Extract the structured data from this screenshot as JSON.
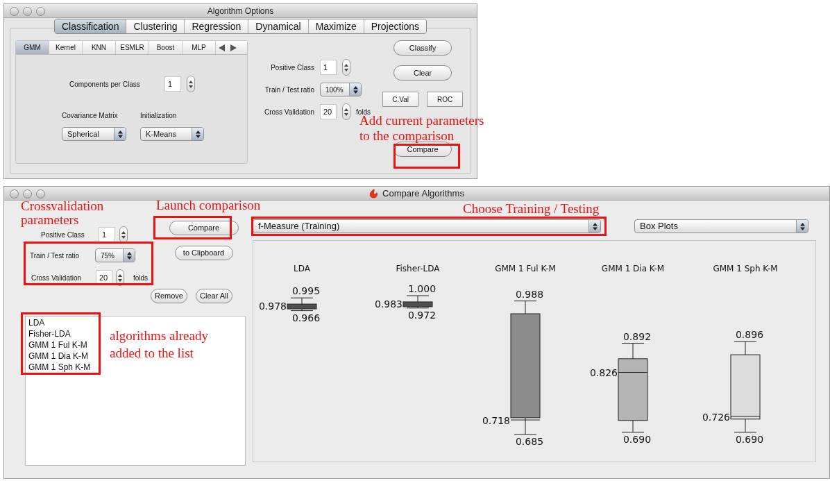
{
  "options_window": {
    "title": "Algorithm Options",
    "tabs": [
      {
        "label": "Classification",
        "selected": true
      },
      {
        "label": "Clustering",
        "selected": false
      },
      {
        "label": "Regression",
        "selected": false
      },
      {
        "label": "Dynamical",
        "selected": false
      },
      {
        "label": "Maximize",
        "selected": false
      },
      {
        "label": "Projections",
        "selected": false
      }
    ],
    "subtabs": [
      {
        "label": "GMM",
        "selected": true
      },
      {
        "label": "Kernel",
        "selected": false
      },
      {
        "label": "KNN",
        "selected": false
      },
      {
        "label": "ESMLR",
        "selected": false
      },
      {
        "label": "Boost",
        "selected": false
      },
      {
        "label": "MLP",
        "selected": false
      }
    ],
    "components_per_class": {
      "label": "Components per Class",
      "value": "1"
    },
    "covariance_matrix": {
      "label": "Covariance Matrix",
      "value": "Spherical"
    },
    "initialization": {
      "label": "Initialization",
      "value": "K-Means"
    },
    "positive_class": {
      "label": "Positive Class",
      "value": "1"
    },
    "train_test_ratio": {
      "label": "Train / Test ratio",
      "value": "100%"
    },
    "cross_validation": {
      "label": "Cross Validation",
      "value": "20",
      "unit": "folds"
    },
    "buttons": [
      "Classify",
      "Clear"
    ],
    "small_buttons": [
      "C.Val",
      "ROC"
    ],
    "compare_button": "Compare"
  },
  "compare_window": {
    "title": "Compare Algorithms",
    "positive_class": {
      "label": "Positive Class",
      "value": "1"
    },
    "train_test_ratio": {
      "label": "Train / Test ratio",
      "value": "75%"
    },
    "cross_validation": {
      "label": "Cross Validation",
      "value": "20",
      "unit": "folds"
    },
    "compare_button": "Compare",
    "clipboard_button": "to Clipboard",
    "remove_button": "Remove",
    "clear_all_button": "Clear All",
    "algorithms": [
      "LDA",
      "Fisher-LDA",
      "GMM 1 Ful K-M",
      "GMM 1 Dia K-M",
      "GMM 1 Sph K-M"
    ],
    "measure": "f-Measure (Training)",
    "plot_type": "Box Plots",
    "boxplots": [
      {
        "name": "LDA",
        "max": "0.995",
        "median": "0.978",
        "min": "0.966",
        "color": "#505050"
      },
      {
        "name": "Fisher-LDA",
        "max": "1.000",
        "median": "0.983",
        "min": "0.972",
        "color": "#505050"
      },
      {
        "name": "GMM 1 Ful K-M",
        "max": "0.988",
        "median": "0.718",
        "min": "0.685",
        "color": "#8c8c8c"
      },
      {
        "name": "GMM 1 Dia K-M",
        "max": "0.892",
        "median": "0.826",
        "min": "0.690",
        "color": "#b4b4b4"
      },
      {
        "name": "GMM 1 Sph K-M",
        "max": "0.896",
        "median": "0.726",
        "min": "0.690",
        "color": "#dcdcdc"
      }
    ]
  },
  "annotations": [
    {
      "lines": [
        "Add current parameters",
        "to the comparison"
      ]
    },
    {
      "lines": [
        "Crossvalidation",
        "parameters"
      ]
    },
    {
      "lines": [
        "Launch comparison"
      ]
    },
    {
      "lines": [
        "Choose Training / Testing"
      ]
    },
    {
      "lines": [
        "algorithms already",
        "added to the list"
      ]
    }
  ]
}
